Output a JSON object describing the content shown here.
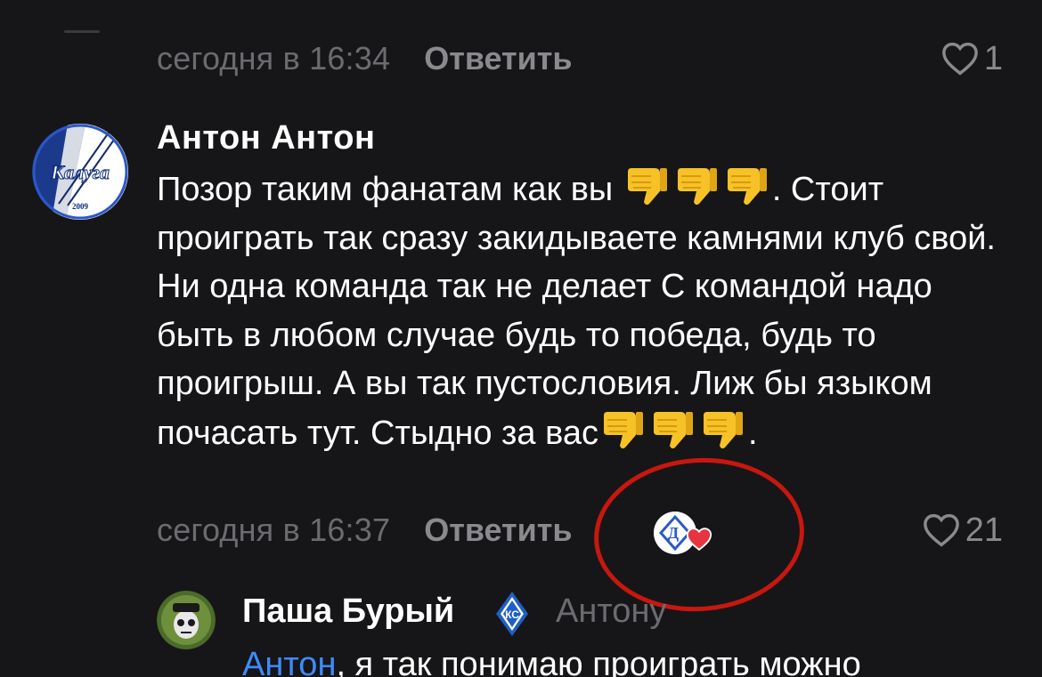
{
  "prev_comment": {
    "time": "сегодня в 16:34",
    "reply_label": "Ответить",
    "likes": "1"
  },
  "comment": {
    "author": "Антон Антон",
    "avatar_text": "Калуга",
    "avatar_year": "2009",
    "body": {
      "part1": "Позор таким фанатам как вы",
      "part2": ". Стоит проиграть так сразу закидываете камнями клуб свой. Ни одна команда так не делает   С командой надо быть в любом случае будь то победа, будь то проигрыш. А вы так пустословия. Лиж бы языком почасать тут. Стыдно за вас",
      "part3": "."
    },
    "time": "сегодня в 16:37",
    "reply_label": "Ответить",
    "likes": "21"
  },
  "reply": {
    "author": "Паша Бурый",
    "to": "Антону",
    "mention": "Антон",
    "text": ", я так понимаю проиграть можно"
  },
  "icons": {
    "like": "heart-outline-icon",
    "thumbs": "thumbs-down-emoji",
    "reaction": "heart-filled-icon",
    "club_badge": "krylia-sovetov-badge"
  },
  "colors": {
    "background": "#161618",
    "secondary_text": "#8a8a8e",
    "muted_text": "#6b6b70",
    "mention": "#3d8bfd",
    "annotation": "#c8170f",
    "heart": "#e8343f"
  }
}
